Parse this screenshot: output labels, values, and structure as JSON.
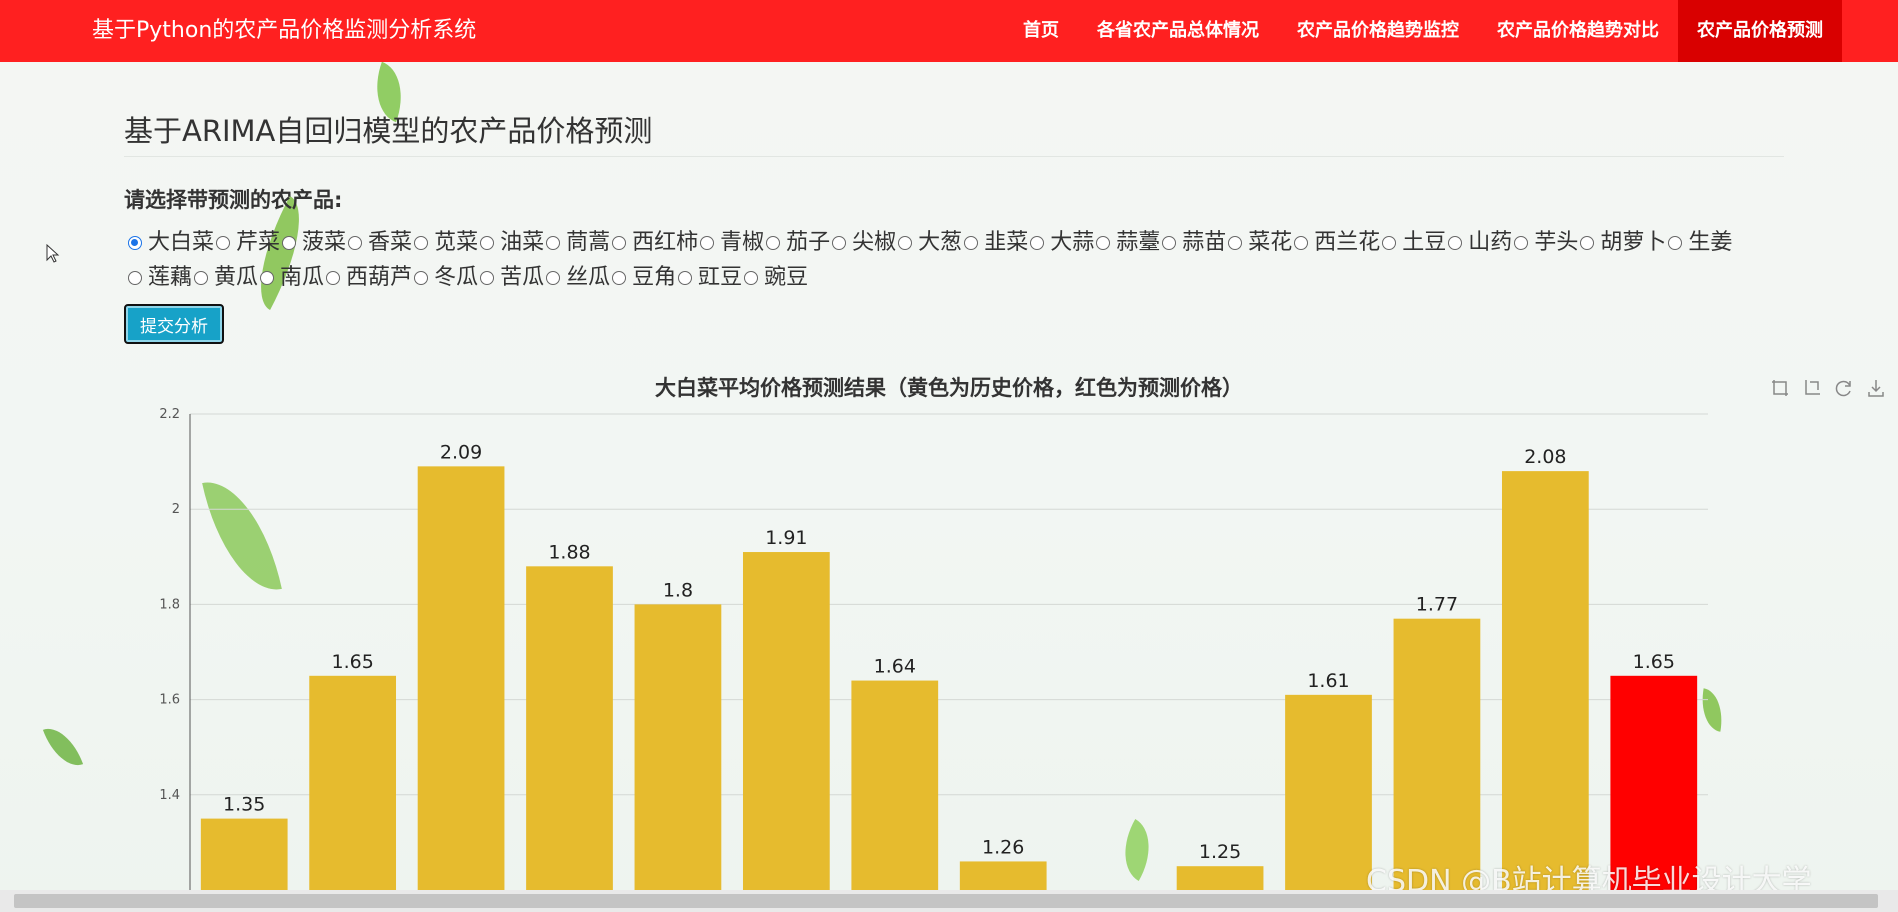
{
  "navbar": {
    "brand": "基于Python的农产品价格监测分析系统",
    "items": [
      {
        "label": "首页"
      },
      {
        "label": "各省农产品总体情况"
      },
      {
        "label": "农产品价格趋势监控"
      },
      {
        "label": "农产品价格趋势对比"
      },
      {
        "label": "农产品价格预测",
        "active": true
      }
    ]
  },
  "page": {
    "title": "基于ARIMA自回归模型的农产品价格预测",
    "select_label": "请选择带预测的农产品:",
    "selected": "大白菜",
    "options": [
      "大白菜",
      "芹菜",
      "菠菜",
      "香菜",
      "苋菜",
      "油菜",
      "茼蒿",
      "西红柿",
      "青椒",
      "茄子",
      "尖椒",
      "大葱",
      "韭菜",
      "大蒜",
      "蒜薹",
      "蒜苗",
      "菜花",
      "西兰花",
      "土豆",
      "山药",
      "芋头",
      "胡萝卜",
      "生姜",
      "莲藕",
      "黄瓜",
      "南瓜",
      "西葫芦",
      "冬瓜",
      "苦瓜",
      "丝瓜",
      "豆角",
      "豇豆",
      "豌豆"
    ],
    "submit_label": "提交分析"
  },
  "toolbox": [
    "zoom-icon",
    "zoom-reset-icon",
    "restore-icon",
    "download-icon"
  ],
  "chart_data": {
    "type": "bar",
    "title": "大白菜平均价格预测结果（黄色为历史价格，红色为预测价格）",
    "y_ticks": [
      1.4,
      1.6,
      1.8,
      2,
      2.2
    ],
    "ylim": [
      1.2,
      2.2
    ],
    "grid": true,
    "values": [
      1.35,
      1.65,
      2.09,
      1.88,
      1.8,
      1.91,
      1.64,
      1.26,
      null,
      1.25,
      1.61,
      1.77,
      2.08,
      1.65
    ],
    "labels": [
      "1.35",
      "1.65",
      "2.09",
      "1.88",
      "1.8",
      "1.91",
      "1.64",
      "1.26",
      "",
      "1.25",
      "1.61",
      "1.77",
      "2.08",
      "1.65"
    ],
    "colors": {
      "history": "#e6bb2e",
      "forecast": "#ff0000"
    },
    "forecast_index": 13
  },
  "watermark": "CSDN @B站计算机毕业设计大学"
}
